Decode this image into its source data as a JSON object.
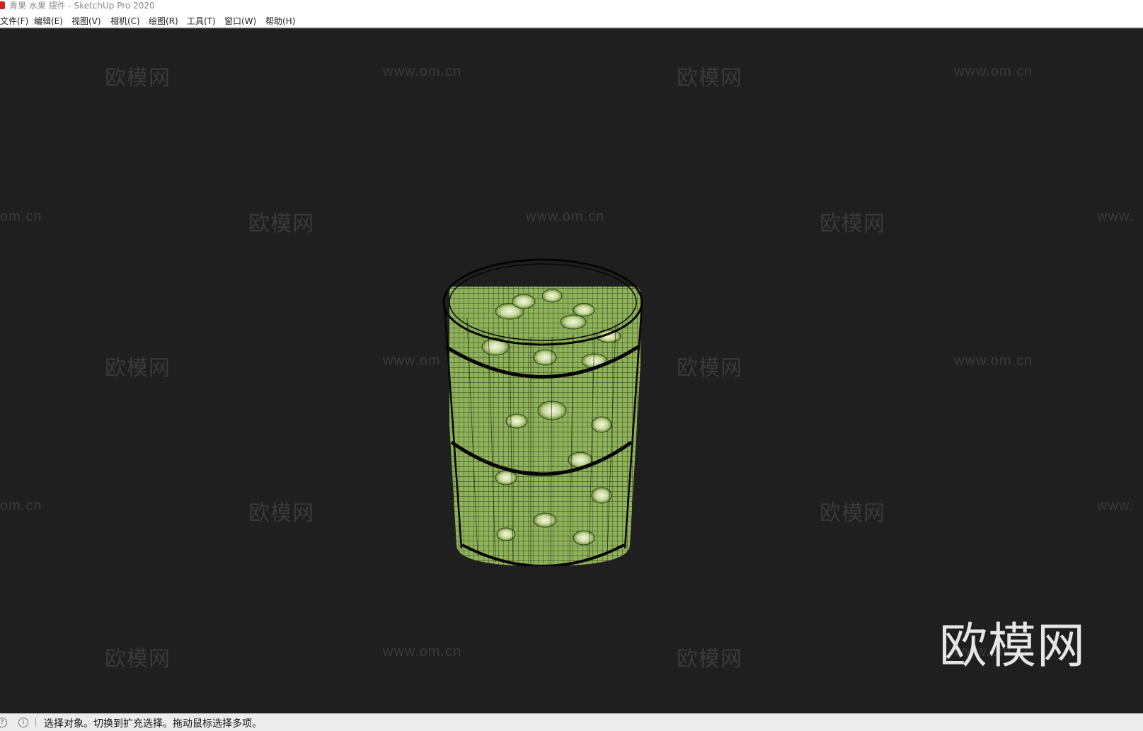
{
  "window": {
    "title": "青果 水果 摆件 - SketchUp Pro 2020",
    "logo_icon": "sketchup-logo-icon"
  },
  "menu": {
    "items": [
      {
        "label": "文件(F)"
      },
      {
        "label": "编辑(E)"
      },
      {
        "label": "视图(V)"
      },
      {
        "label": "相机(C)"
      },
      {
        "label": "绘图(R)"
      },
      {
        "label": "工具(T)"
      },
      {
        "label": "窗口(W)"
      },
      {
        "label": "帮助(H)"
      }
    ]
  },
  "watermark": {
    "cn": "欧模网",
    "url": "www.om.cn",
    "url_partial": "om.cn",
    "url_cut": "www.",
    "url_cut_mid": "www.om",
    "big": "欧模网",
    "color": "#3a3a3a"
  },
  "viewport": {
    "background": "#1f1f1f",
    "model_icon": "fruit-basket-model",
    "fruit_color": "#8fb35a"
  },
  "status": {
    "icons": [
      "geo-location-icon",
      "info-icon"
    ],
    "text": "选择对象。切换到扩充选择。拖动鼠标选择多项。"
  }
}
